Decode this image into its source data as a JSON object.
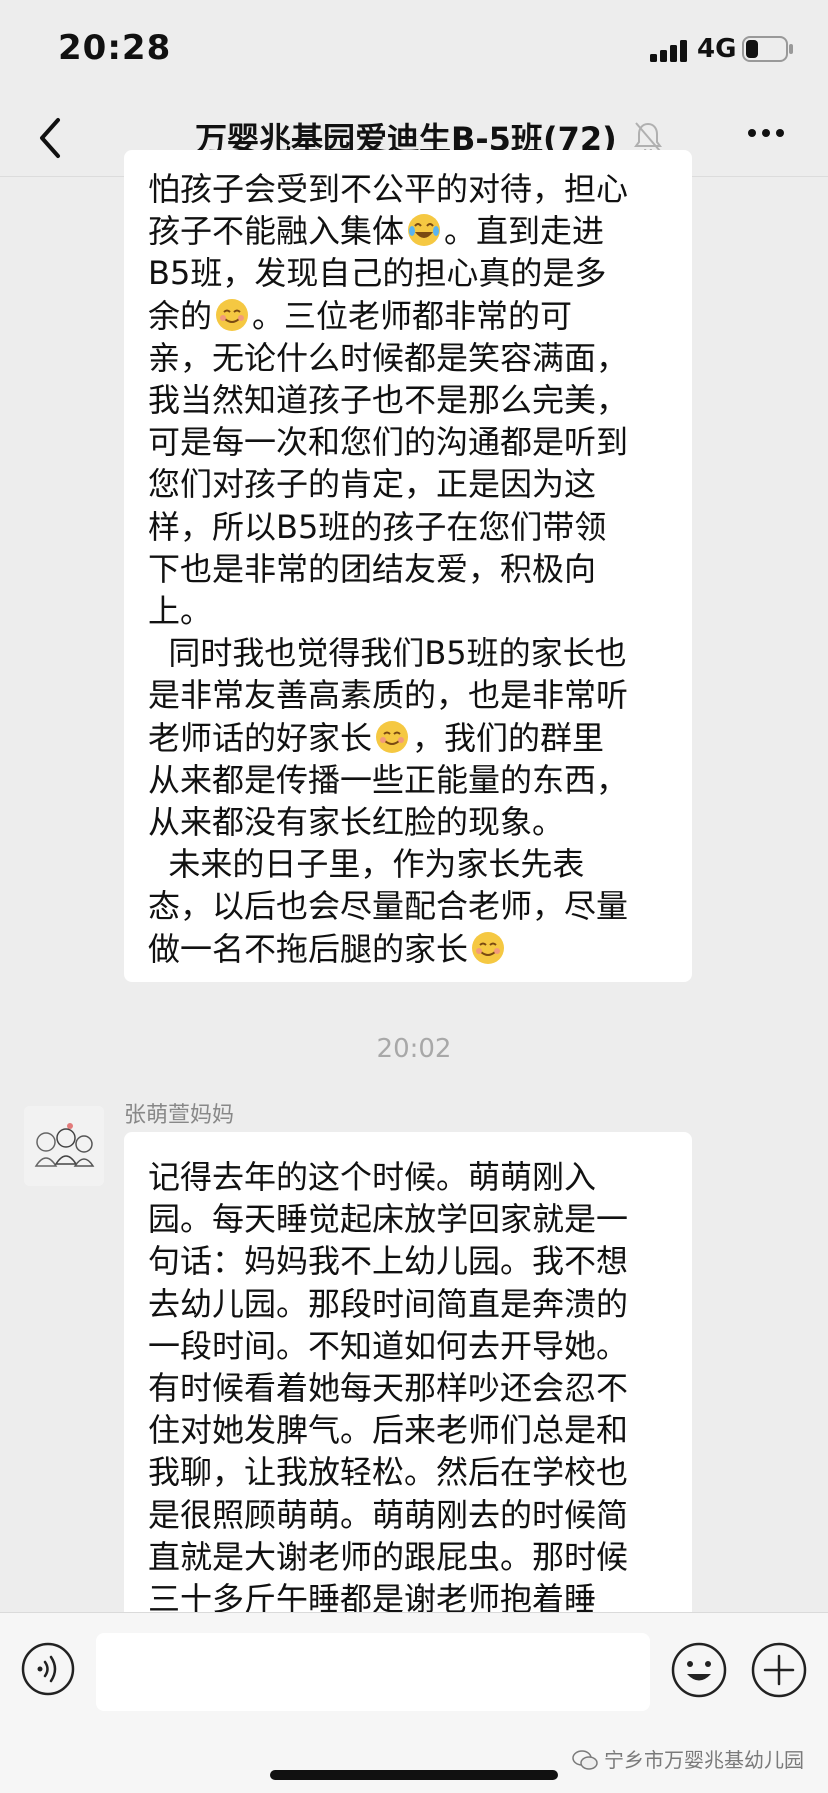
{
  "status_bar": {
    "time": "20:28",
    "network": "4G"
  },
  "header": {
    "title": "万婴兆基园爱迪生B-5班(72)"
  },
  "messages": [
    {
      "lines": [
        "怕孩子会受到不公平的对待，担心",
        "孩子不能融入集体",
        "。直到走进",
        "B5班，发现自己的担心真的是多",
        "余的",
        "。三位老师都非常的可",
        "亲，无论什么时候都是笑容满面，",
        "我当然知道孩子也不是那么完美，",
        "可是每一次和您们的沟通都是听到",
        "您们对孩子的肯定，正是因为这",
        "样，所以B5班的孩子在您们带领",
        "下也是非常的团结友爱，积极向",
        "上。",
        "  同时我也觉得我们B5班的家长也",
        "是非常友善高素质的，也是非常听",
        "老师话的好家长",
        "，我们的群里",
        "从来都是传播一些正能量的东西，",
        "从来都没有家长红脸的现象。",
        "  未来的日子里，作为家长先表",
        "态，以后也会尽量配合老师，尽量",
        "做一名不拖后腿的家长"
      ]
    },
    {
      "sender": "张萌萱妈妈",
      "lines": [
        "记得去年的这个时候。萌萌刚入",
        "园。每天睡觉起床放学回家就是一",
        "句话：妈妈我不上幼儿园。我不想",
        "去幼儿园。那段时间简直是奔溃的",
        "一段时间。不知道如何去开导她。",
        "有时候看着她每天那样吵还会忍不",
        "住对她发脾气。后来老师们总是和",
        "我聊，让我放轻松。然后在学校也",
        "是很照顾萌萌。萌萌刚去的时候简",
        "直就是大谢老师的跟屁虫。那时候",
        "三十多斤午睡都是谢老师抱着睡"
      ]
    }
  ],
  "timestamp": "20:02",
  "watermark": "宁乡市万婴兆基幼儿园",
  "icons": {
    "back": "chevron-left-icon",
    "mute": "bell-off-icon",
    "more": "more-dots-icon",
    "voice": "voice-icon",
    "emoji": "emoji-icon",
    "plus": "plus-icon"
  },
  "colors": {
    "background": "#ededed",
    "bubble": "#ffffff",
    "emoji": "#f5c842",
    "meta_text": "#a8a8a8"
  }
}
